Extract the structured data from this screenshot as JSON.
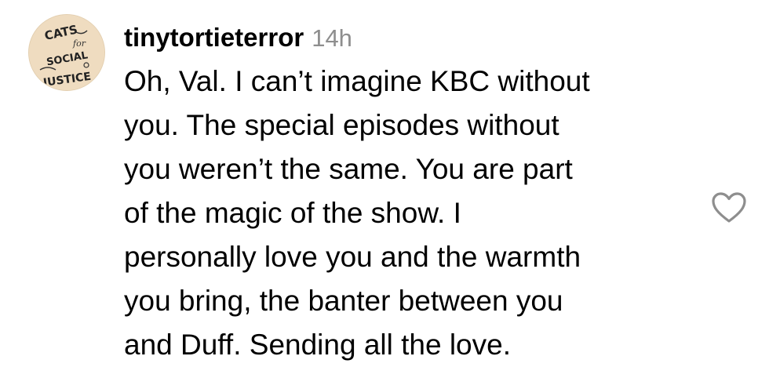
{
  "comment": {
    "username": "tinytortieterror",
    "timestamp": "14h",
    "text": "Oh, Val. I can’t imagine KBC without\nyou. The special episodes without\nyou weren’t the same. You are part\nof the magic of the show. I\npersonally love you and the warmth\nyou bring, the banter between you\nand Duff. Sending all the love.",
    "avatar": {
      "description_icon": "avatar-icon",
      "lettering": [
        "CATS",
        "for",
        "SOCIAL",
        "JUSTICE"
      ]
    },
    "like_icon": "heart-outline-icon"
  },
  "colors": {
    "text": "#000000",
    "timestamp": "#8e8e8e",
    "avatar_bg": "#efdcc0",
    "icon_stroke": "#8e8e8e"
  }
}
